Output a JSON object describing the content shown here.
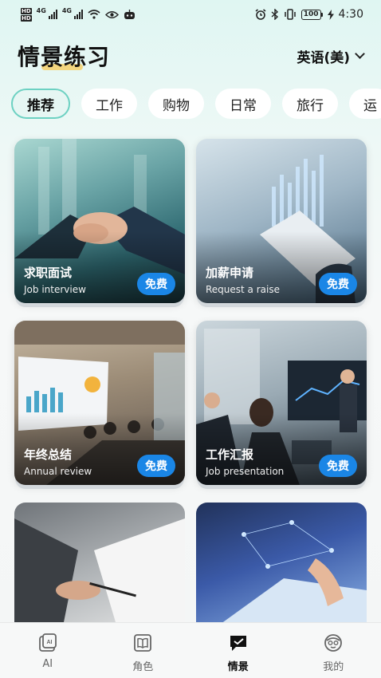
{
  "status_bar": {
    "sim_labels": [
      "HD",
      "HD"
    ],
    "network_1": "4G",
    "network_2": "4G",
    "battery": "100",
    "time": "4:30"
  },
  "header": {
    "title": "情景练习",
    "language": "英语(美)"
  },
  "tabs": [
    {
      "label": "推荐",
      "active": true
    },
    {
      "label": "工作",
      "active": false
    },
    {
      "label": "购物",
      "active": false
    },
    {
      "label": "日常",
      "active": false
    },
    {
      "label": "旅行",
      "active": false
    },
    {
      "label": "运",
      "active": false
    }
  ],
  "cards": [
    {
      "title": "求职面试",
      "subtitle": "Job interview",
      "badge": "免费"
    },
    {
      "title": "加薪申请",
      "subtitle": "Request a raise",
      "badge": "免费"
    },
    {
      "title": "年终总结",
      "subtitle": "Annual review",
      "badge": "免费"
    },
    {
      "title": "工作汇报",
      "subtitle": "Job presentation",
      "badge": "免费"
    }
  ],
  "bottom_nav": [
    {
      "label": "AI",
      "icon": "ai-icon",
      "active": false
    },
    {
      "label": "角色",
      "icon": "book-icon",
      "active": false
    },
    {
      "label": "情景",
      "icon": "scene-icon",
      "active": true
    },
    {
      "label": "我的",
      "icon": "profile-icon",
      "active": false
    }
  ],
  "colors": {
    "accent": "#6dd1c2",
    "badge": "#1a86e6",
    "highlight": "#f5d06a"
  }
}
